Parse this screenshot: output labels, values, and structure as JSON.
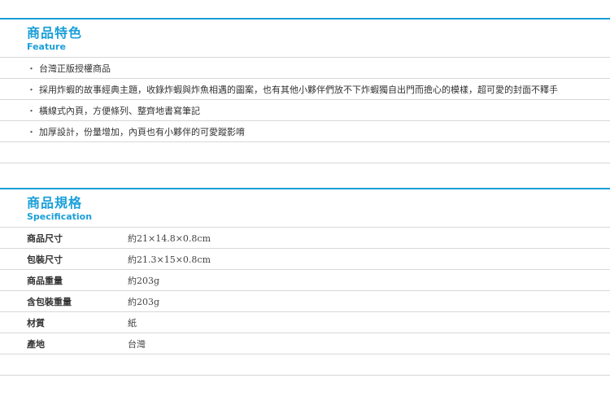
{
  "feature": {
    "title_zh": "商品特色",
    "title_en": "Feature",
    "bullet": "・",
    "items": [
      "台灣正版授權商品",
      "採用炸蝦的故事經典主題，收錄炸蝦與炸魚相遇的圖案，也有其他小夥伴們放不下炸蝦獨自出門而擔心的模樣，超可愛的封面不釋手",
      "橫線式內頁，方便條列、整齊地書寫筆記",
      "加厚設計，份量增加，內頁也有小夥伴的可愛蹤影唷"
    ]
  },
  "spec": {
    "title_zh": "商品規格",
    "title_en": "Specification",
    "rows": [
      {
        "label": "商品尺寸",
        "value": "約21×14.8×0.8cm"
      },
      {
        "label": "包裝尺寸",
        "value": "約21.3×15×0.8cm"
      },
      {
        "label": "商品重量",
        "value": "約203g"
      },
      {
        "label": "含包裝重量",
        "value": "約203g"
      },
      {
        "label": "材質",
        "value": "紙"
      },
      {
        "label": "產地",
        "value": "台灣"
      }
    ]
  },
  "colors": {
    "accent": "#1a9fd8",
    "divider": "#d8d8d8"
  }
}
